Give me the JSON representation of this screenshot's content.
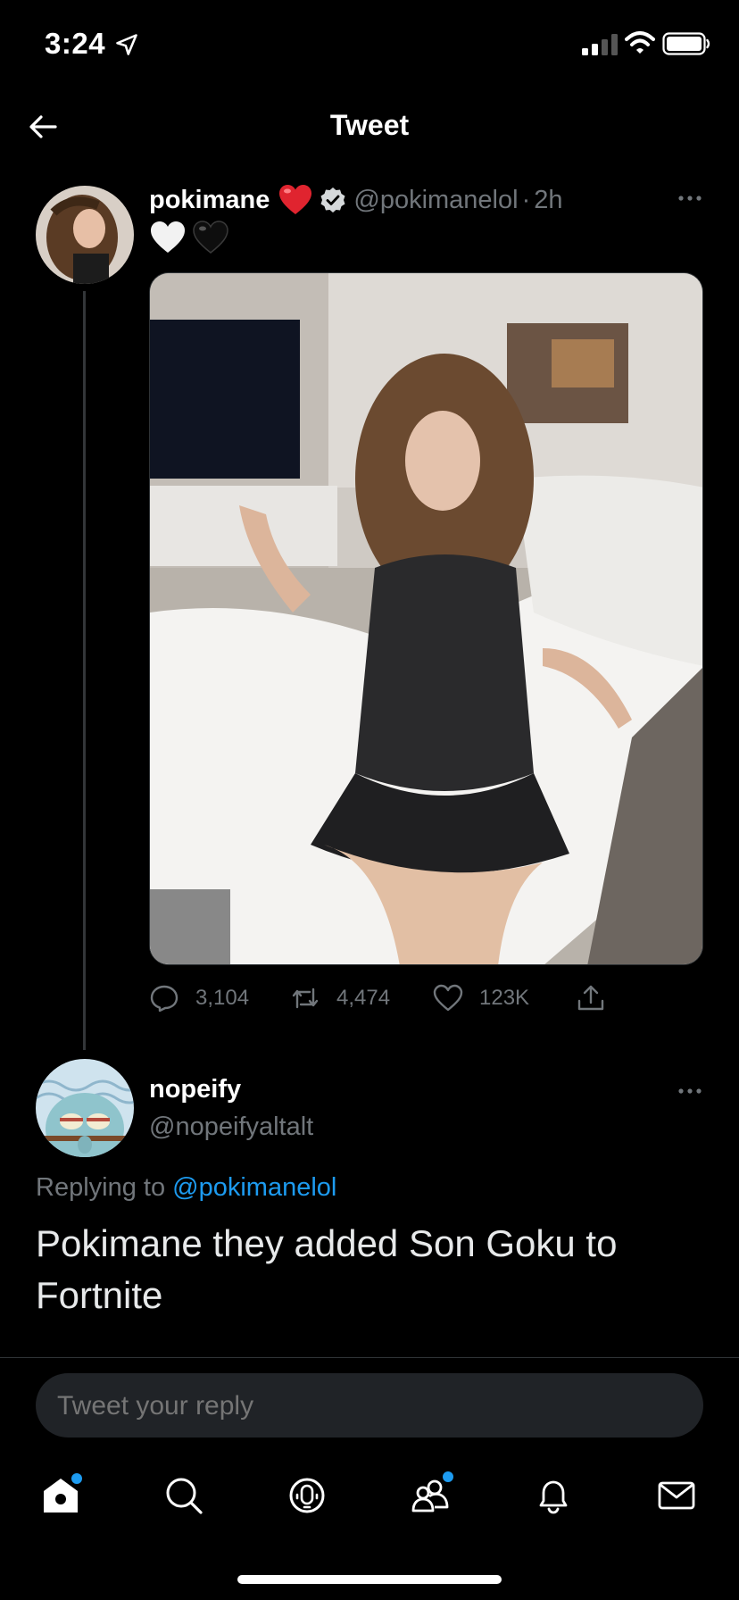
{
  "status_bar": {
    "time": "3:24"
  },
  "header": {
    "title": "Tweet"
  },
  "tweet": {
    "display_name": "pokimane",
    "handle": "@pokimanelol",
    "separator": "·",
    "time": "2h",
    "emojis": [
      "white-heart",
      "black-heart"
    ],
    "stats": {
      "replies": "3,104",
      "retweets": "4,474",
      "likes": "123K"
    }
  },
  "reply": {
    "display_name": "nopeify",
    "handle": "@nopeifyaltalt",
    "replying_to_prefix": "Replying to",
    "replying_to_handle": "@pokimanelol",
    "text": "Pokimane they added Son Goku to Fortnite"
  },
  "composer": {
    "placeholder": "Tweet your reply"
  },
  "tab_bar": {
    "items": [
      "home-icon",
      "search-icon",
      "spaces-icon",
      "communities-icon",
      "notifications-icon",
      "messages-icon"
    ]
  },
  "colors": {
    "accent": "#1d9bf0",
    "background": "#000000",
    "secondary_text": "#71767b"
  }
}
